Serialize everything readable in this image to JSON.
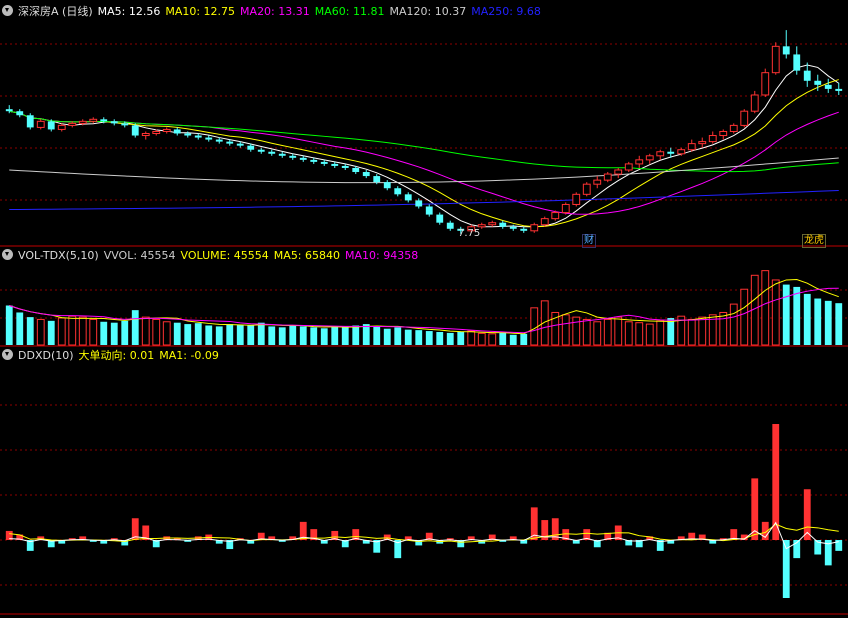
{
  "panel1": {
    "title": "深深房A (日线)",
    "legend": [
      {
        "label": "MA5: 12.56",
        "color": "#ffffff"
      },
      {
        "label": "MA10: 12.75",
        "color": "#ffff00"
      },
      {
        "label": "MA20: 13.31",
        "color": "#ff00ff"
      },
      {
        "label": "MA60: 11.81",
        "color": "#00ff00"
      },
      {
        "label": "MA120: 10.37",
        "color": "#cccccc"
      },
      {
        "label": "MA250: 9.68",
        "color": "#2222ff"
      }
    ],
    "low_label": "7.75",
    "tags": [
      "财",
      "龙虎"
    ]
  },
  "panel2": {
    "title": "VOL-TDX(5,10)",
    "legend": [
      {
        "label": "VVOL: 45554",
        "color": "#cccccc"
      },
      {
        "label": "VOLUME: 45554",
        "color": "#ffff00"
      },
      {
        "label": "MA5: 65840",
        "color": "#ffff00"
      },
      {
        "label": "MA10: 94358",
        "color": "#ff00ff"
      }
    ]
  },
  "panel3": {
    "title": "DDXD(10)",
    "legend": [
      {
        "label": "大单动向: 0.01",
        "color": "#ffff00"
      },
      {
        "label": "MA1: -0.09",
        "color": "#ffff00"
      }
    ]
  },
  "colors": {
    "up": "#ff3232",
    "down": "#54ffff",
    "grid": "#8b0000",
    "border": "#c00000"
  },
  "chart_data": [
    {
      "type": "candlestick",
      "ohlc": [
        [
          13.9,
          14.1,
          13.7,
          13.8
        ],
        [
          13.8,
          13.9,
          13.5,
          13.6
        ],
        [
          13.6,
          13.7,
          12.9,
          13.0
        ],
        [
          13.0,
          13.4,
          12.9,
          13.3
        ],
        [
          13.3,
          13.4,
          12.8,
          12.9
        ],
        [
          12.9,
          13.2,
          12.8,
          13.1
        ],
        [
          13.1,
          13.3,
          13.0,
          13.2
        ],
        [
          13.2,
          13.4,
          13.1,
          13.3
        ],
        [
          13.3,
          13.5,
          13.2,
          13.4
        ],
        [
          13.4,
          13.5,
          13.2,
          13.3
        ],
        [
          13.3,
          13.4,
          13.1,
          13.2
        ],
        [
          13.2,
          13.3,
          13.0,
          13.1
        ],
        [
          13.1,
          13.2,
          12.5,
          12.6
        ],
        [
          12.6,
          12.8,
          12.4,
          12.7
        ],
        [
          12.7,
          12.9,
          12.6,
          12.8
        ],
        [
          12.8,
          13.0,
          12.7,
          12.9
        ],
        [
          12.9,
          13.0,
          12.6,
          12.7
        ],
        [
          12.7,
          12.8,
          12.5,
          12.6
        ],
        [
          12.6,
          12.7,
          12.4,
          12.5
        ],
        [
          12.5,
          12.6,
          12.3,
          12.4
        ],
        [
          12.4,
          12.5,
          12.2,
          12.3
        ],
        [
          12.3,
          12.4,
          12.1,
          12.2
        ],
        [
          12.2,
          12.3,
          12.0,
          12.1
        ],
        [
          12.1,
          12.2,
          11.8,
          11.9
        ],
        [
          11.9,
          12.0,
          11.7,
          11.8
        ],
        [
          11.8,
          11.9,
          11.6,
          11.7
        ],
        [
          11.7,
          11.8,
          11.5,
          11.6
        ],
        [
          11.6,
          11.7,
          11.4,
          11.5
        ],
        [
          11.5,
          11.6,
          11.3,
          11.4
        ],
        [
          11.4,
          11.5,
          11.2,
          11.3
        ],
        [
          11.3,
          11.4,
          11.1,
          11.2
        ],
        [
          11.2,
          11.3,
          11.0,
          11.1
        ],
        [
          11.1,
          11.2,
          10.9,
          11.0
        ],
        [
          11.0,
          11.1,
          10.7,
          10.8
        ],
        [
          10.8,
          10.9,
          10.5,
          10.6
        ],
        [
          10.6,
          10.7,
          10.2,
          10.3
        ],
        [
          10.3,
          10.4,
          9.9,
          10.0
        ],
        [
          10.0,
          10.1,
          9.6,
          9.7
        ],
        [
          9.7,
          9.8,
          9.3,
          9.4
        ],
        [
          9.4,
          9.5,
          9.0,
          9.1
        ],
        [
          9.1,
          9.2,
          8.6,
          8.7
        ],
        [
          8.7,
          8.8,
          8.2,
          8.3
        ],
        [
          8.3,
          8.4,
          7.9,
          8.0
        ],
        [
          8.0,
          8.1,
          7.75,
          7.9
        ],
        [
          7.9,
          8.2,
          7.8,
          8.1
        ],
        [
          8.1,
          8.3,
          8.0,
          8.2
        ],
        [
          8.2,
          8.4,
          8.1,
          8.3
        ],
        [
          8.3,
          8.4,
          8.0,
          8.1
        ],
        [
          8.1,
          8.2,
          7.9,
          8.0
        ],
        [
          8.0,
          8.1,
          7.8,
          7.9
        ],
        [
          7.9,
          8.3,
          7.8,
          8.2
        ],
        [
          8.2,
          8.6,
          8.1,
          8.5
        ],
        [
          8.5,
          8.9,
          8.4,
          8.8
        ],
        [
          8.8,
          9.3,
          8.7,
          9.2
        ],
        [
          9.2,
          9.8,
          9.1,
          9.7
        ],
        [
          9.7,
          10.3,
          9.6,
          10.2
        ],
        [
          10.2,
          10.6,
          10.0,
          10.4
        ],
        [
          10.4,
          10.8,
          10.3,
          10.7
        ],
        [
          10.7,
          11.0,
          10.5,
          10.9
        ],
        [
          10.9,
          11.3,
          10.8,
          11.2
        ],
        [
          11.2,
          11.6,
          11.0,
          11.4
        ],
        [
          11.4,
          11.7,
          11.2,
          11.6
        ],
        [
          11.6,
          11.9,
          11.4,
          11.8
        ],
        [
          11.8,
          12.0,
          11.5,
          11.7
        ],
        [
          11.7,
          12.0,
          11.6,
          11.9
        ],
        [
          11.9,
          12.4,
          11.8,
          12.2
        ],
        [
          12.2,
          12.5,
          12.0,
          12.3
        ],
        [
          12.3,
          12.8,
          12.2,
          12.6
        ],
        [
          12.6,
          12.9,
          12.4,
          12.8
        ],
        [
          12.8,
          13.2,
          12.7,
          13.1
        ],
        [
          13.1,
          13.9,
          13.0,
          13.8
        ],
        [
          13.8,
          14.8,
          13.7,
          14.6
        ],
        [
          14.6,
          15.9,
          14.5,
          15.7
        ],
        [
          15.7,
          17.2,
          15.6,
          17.0
        ],
        [
          17.0,
          17.8,
          16.4,
          16.6
        ],
        [
          16.6,
          17.0,
          15.6,
          15.8
        ],
        [
          15.8,
          16.2,
          15.0,
          15.3
        ],
        [
          15.3,
          15.6,
          14.8,
          15.1
        ],
        [
          15.1,
          15.4,
          14.7,
          14.9
        ],
        [
          14.9,
          15.2,
          14.6,
          14.8
        ]
      ],
      "ma": {
        "MA5": 12.56,
        "MA10": 12.75,
        "MA20": 13.31,
        "MA60": 11.81,
        "MA120": 10.37,
        "MA250": 9.68
      }
    },
    {
      "type": "bar",
      "volume": [
        85,
        70,
        60,
        55,
        52,
        58,
        62,
        60,
        55,
        50,
        48,
        52,
        75,
        60,
        55,
        50,
        48,
        45,
        47,
        42,
        40,
        45,
        43,
        42,
        48,
        40,
        38,
        42,
        40,
        38,
        36,
        40,
        38,
        42,
        45,
        40,
        35,
        38,
        33,
        32,
        30,
        28,
        26,
        28,
        30,
        25,
        24,
        26,
        22,
        24,
        80,
        95,
        70,
        65,
        60,
        55,
        50,
        55,
        60,
        50,
        48,
        45,
        52,
        58,
        62,
        55,
        60,
        65,
        70,
        88,
        120,
        150,
        160,
        140,
        130,
        125,
        110,
        100,
        95,
        90
      ]
    },
    {
      "type": "bar",
      "ddx": [
        0.25,
        0.15,
        -0.3,
        0.1,
        -0.2,
        -0.1,
        0.05,
        0.1,
        -0.05,
        -0.1,
        0.05,
        -0.15,
        0.6,
        0.4,
        -0.2,
        0.1,
        0.05,
        -0.05,
        0.1,
        0.15,
        -0.1,
        -0.25,
        0.05,
        -0.1,
        0.2,
        0.1,
        -0.05,
        0.1,
        0.5,
        0.3,
        -0.1,
        0.25,
        -0.2,
        0.3,
        -0.1,
        -0.35,
        0.15,
        -0.5,
        0.1,
        -0.15,
        0.2,
        -0.1,
        0.05,
        -0.2,
        0.1,
        -0.1,
        0.15,
        -0.05,
        0.1,
        -0.1,
        0.9,
        0.55,
        0.6,
        0.3,
        -0.1,
        0.3,
        -0.2,
        0.2,
        0.4,
        -0.15,
        -0.2,
        0.1,
        -0.3,
        -0.1,
        0.1,
        0.2,
        0.15,
        -0.1,
        0.05,
        0.3,
        0.15,
        1.7,
        0.5,
        3.2,
        -1.6,
        -0.5,
        1.4,
        -0.4,
        -0.7,
        -0.3
      ]
    }
  ]
}
